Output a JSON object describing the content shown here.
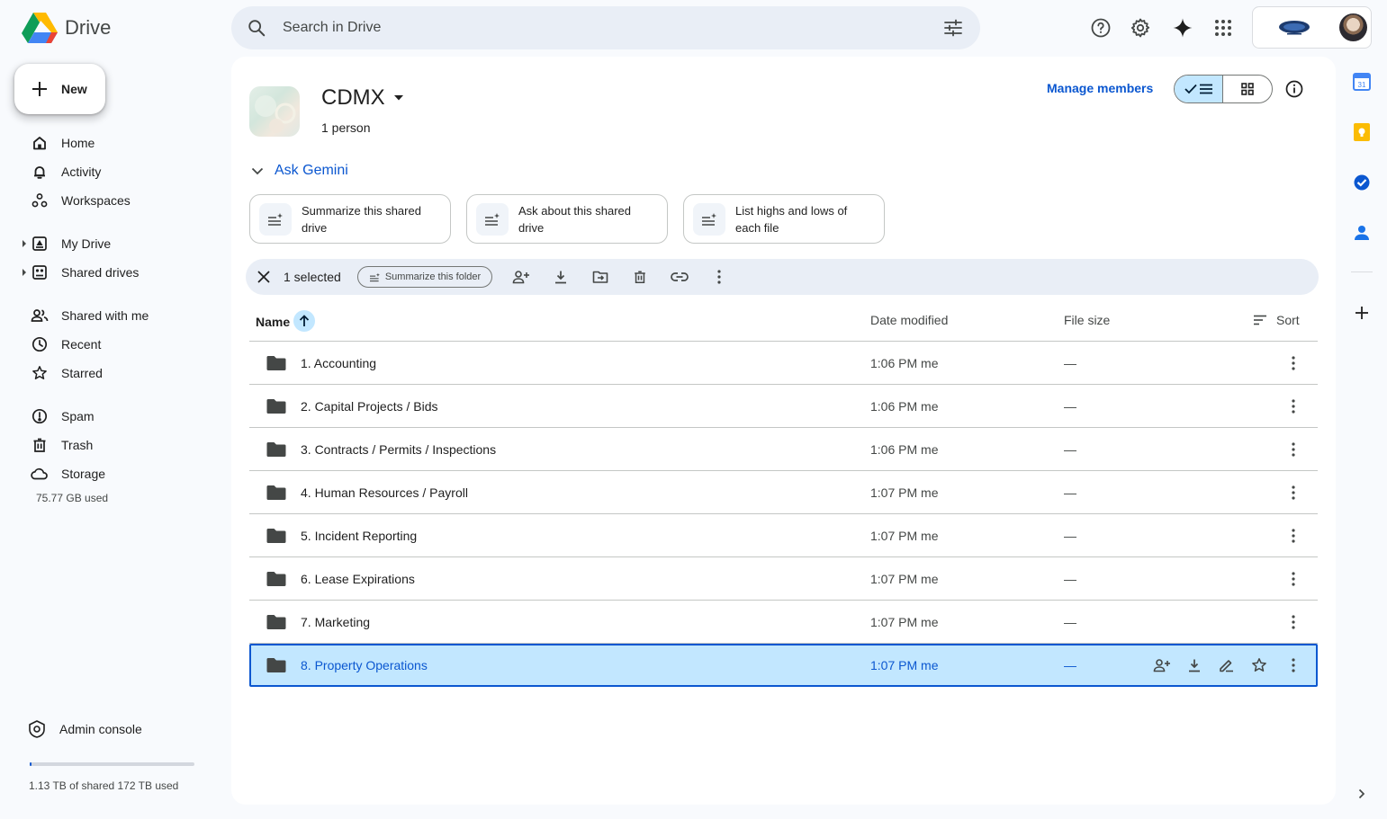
{
  "app": {
    "name": "Drive"
  },
  "search": {
    "placeholder": "Search in Drive"
  },
  "sidebar": {
    "new_label": "New",
    "items": [
      {
        "label": "Home",
        "icon": "home-icon"
      },
      {
        "label": "Activity",
        "icon": "bell-icon"
      },
      {
        "label": "Workspaces",
        "icon": "workspaces-icon"
      },
      {
        "label": "My Drive",
        "icon": "my-drive-icon"
      },
      {
        "label": "Shared drives",
        "icon": "shared-drives-icon"
      },
      {
        "label": "Shared with me",
        "icon": "people-icon"
      },
      {
        "label": "Recent",
        "icon": "clock-icon"
      },
      {
        "label": "Starred",
        "icon": "star-icon"
      },
      {
        "label": "Spam",
        "icon": "spam-icon"
      },
      {
        "label": "Trash",
        "icon": "trash-icon"
      },
      {
        "label": "Storage",
        "icon": "cloud-icon"
      }
    ],
    "storage_used": "75.77 GB used",
    "admin_label": "Admin console",
    "quota_text": "1.13 TB of shared 172 TB used",
    "quota_fraction": 0.0066
  },
  "drive": {
    "title": "CDMX",
    "members": "1 person",
    "manage_members": "Manage members"
  },
  "gemini": {
    "label": "Ask Gemini",
    "chips": [
      "Summarize this shared drive",
      "Ask about this shared drive",
      "List highs and lows of each file"
    ]
  },
  "selection": {
    "count_label": "1 selected",
    "summarize_folder": "Summarize this folder"
  },
  "table": {
    "headers": {
      "name": "Name",
      "date": "Date modified",
      "size": "File size",
      "sort": "Sort"
    },
    "rows": [
      {
        "name": "1. Accounting",
        "date": "1:06 PM me",
        "size": "—"
      },
      {
        "name": "2. Capital Projects / Bids",
        "date": "1:06 PM me",
        "size": "—"
      },
      {
        "name": "3. Contracts / Permits / Inspections",
        "date": "1:06 PM me",
        "size": "—"
      },
      {
        "name": "4. Human Resources / Payroll",
        "date": "1:07 PM me",
        "size": "—"
      },
      {
        "name": "5. Incident Reporting",
        "date": "1:07 PM me",
        "size": "—"
      },
      {
        "name": "6. Lease Expirations",
        "date": "1:07 PM me",
        "size": "—"
      },
      {
        "name": "7. Marketing",
        "date": "1:07 PM me",
        "size": "—"
      },
      {
        "name": "8. Property Operations",
        "date": "1:07 PM me",
        "size": "—",
        "selected": true
      }
    ]
  },
  "colors": {
    "accent": "#0b57d0",
    "selected_bg": "#c2e7ff",
    "search_bg": "#e9eef6",
    "page_bg": "#f8fafd"
  }
}
